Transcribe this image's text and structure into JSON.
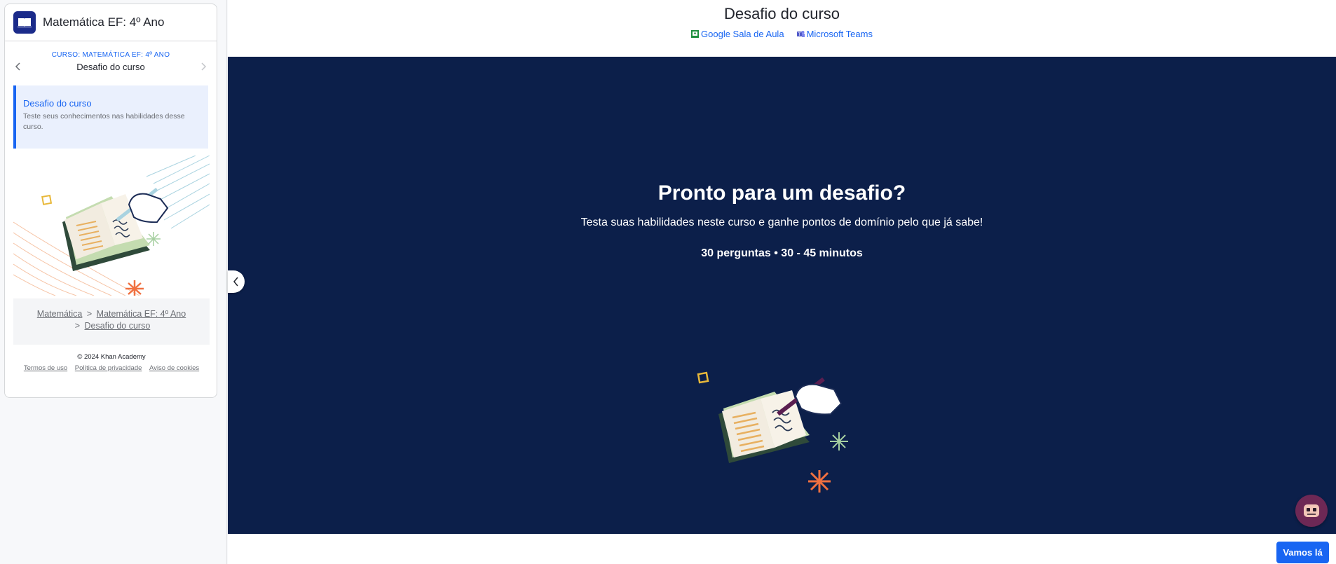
{
  "sidebar": {
    "course_title": "Matemática EF: 4º Ano",
    "unit_eyebrow": "CURSO: MATEMÁTICA EF: 4º ANO",
    "unit_name": "Desafio do curso",
    "challenge": {
      "title": "Desafio do curso",
      "description": "Teste seus conhecimentos nas habilidades desse curso."
    },
    "breadcrumb": [
      {
        "label": "Matemática"
      },
      {
        "label": "Matemática EF: 4º Ano"
      },
      {
        "label": "Desafio do curso"
      }
    ],
    "breadcrumb_separator": ">",
    "footer": {
      "copyright": "© 2024 Khan Academy",
      "links": [
        "Termos de uso",
        "Política de privacidade",
        "Aviso de cookies"
      ]
    }
  },
  "main": {
    "title": "Desafio do curso",
    "share": {
      "google": "Google Sala de Aula",
      "teams": "Microsoft Teams"
    },
    "hero": {
      "heading": "Pronto para um desafio?",
      "subheading": "Testa suas habilidades neste curso e ganhe pontos de domínio pelo que já sabe!",
      "meta": "30 perguntas • 30 - 45 minutos"
    },
    "start_button": "Vamos lá"
  },
  "colors": {
    "accent": "#1865f2",
    "hero_bg": "#0c1f4a",
    "logo_bg": "#1b2b8a",
    "assistant_bg": "#6e2855"
  },
  "icons": [
    "book-logo-icon",
    "chevron-left-icon",
    "chevron-right-icon",
    "google-classroom-icon",
    "microsoft-teams-icon",
    "collapse-chevron-icon",
    "assistant-avatar-icon"
  ]
}
